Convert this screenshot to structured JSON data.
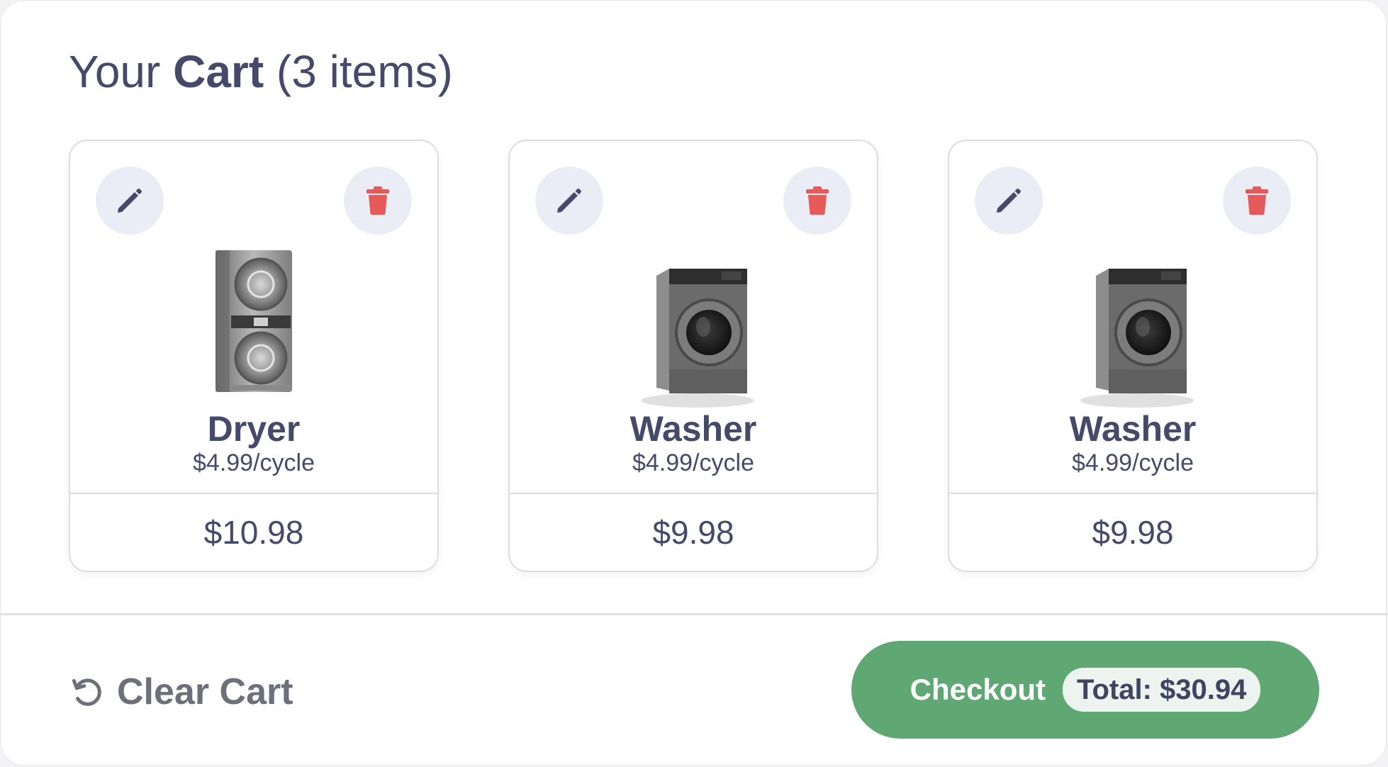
{
  "cart": {
    "title_prefix": "Your",
    "title_bold": "Cart",
    "title_count": "(3 items)"
  },
  "items": [
    {
      "name": "Dryer",
      "rate": "$4.99/cycle",
      "total": "$10.98",
      "image": "stacked-dryer-image"
    },
    {
      "name": "Washer",
      "rate": "$4.99/cycle",
      "total": "$9.98",
      "image": "front-load-washer-image"
    },
    {
      "name": "Washer",
      "rate": "$4.99/cycle",
      "total": "$9.98",
      "image": "front-load-washer-image"
    }
  ],
  "footer": {
    "clear_label": "Clear Cart",
    "checkout_label": "Checkout",
    "total_label": "Total: $30.94"
  },
  "icons": {
    "edit": "pencil-icon",
    "delete": "trash-icon",
    "clear": "undo-icon"
  },
  "colors": {
    "text": "#454a6b",
    "delete_icon": "#e75a5a",
    "icon_bg": "#ebedf6",
    "checkout_bg": "#5fa873",
    "total_pill_bg": "#edf4ef"
  }
}
